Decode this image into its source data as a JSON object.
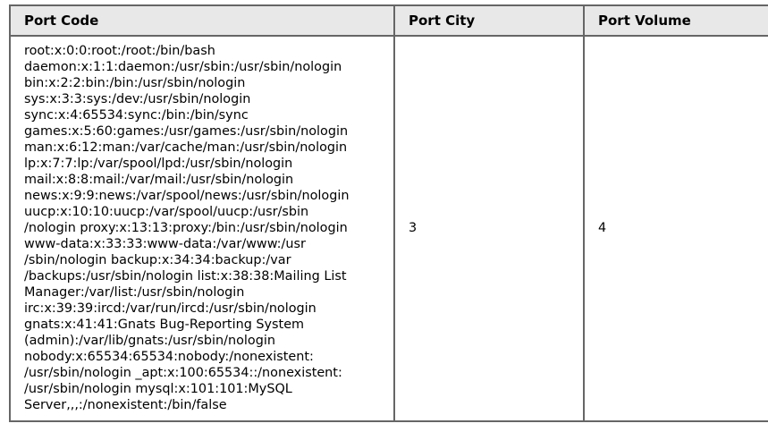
{
  "table": {
    "headers": {
      "code": "Port Code",
      "city": "Port City",
      "volume": "Port Volume"
    },
    "row": {
      "code_lines": [
        "root:x:0:0:root:/root:/bin/bash",
        "daemon:x:1:1:daemon:/usr/sbin:/usr/sbin/nologin",
        "bin:x:2:2:bin:/bin:/usr/sbin/nologin",
        "sys:x:3:3:sys:/dev:/usr/sbin/nologin",
        "sync:x:4:65534:sync:/bin:/bin/sync",
        "games:x:5:60:games:/usr/games:/usr/sbin/nologin",
        "man:x:6:12:man:/var/cache/man:/usr/sbin/nologin",
        "lp:x:7:7:lp:/var/spool/lpd:/usr/sbin/nologin",
        "mail:x:8:8:mail:/var/mail:/usr/sbin/nologin",
        "news:x:9:9:news:/var/spool/news:/usr/sbin/nologin",
        "uucp:x:10:10:uucp:/var/spool/uucp:/usr/sbin",
        "/nologin proxy:x:13:13:proxy:/bin:/usr/sbin/nologin",
        "www-data:x:33:33:www-data:/var/www:/usr",
        "/sbin/nologin backup:x:34:34:backup:/var",
        "/backups:/usr/sbin/nologin list:x:38:38:Mailing List",
        "Manager:/var/list:/usr/sbin/nologin",
        "irc:x:39:39:ircd:/var/run/ircd:/usr/sbin/nologin",
        "gnats:x:41:41:Gnats Bug-Reporting System",
        "(admin):/var/lib/gnats:/usr/sbin/nologin",
        "nobody:x:65534:65534:nobody:/nonexistent:",
        "/usr/sbin/nologin _apt:x:100:65534::/nonexistent:",
        "/usr/sbin/nologin mysql:x:101:101:MySQL",
        "Server,,,:/nonexistent:/bin/false"
      ],
      "city": "3",
      "volume": "4"
    }
  },
  "colors": {
    "header_bg": "#e8e8e8",
    "border": "#666666",
    "text": "#000000",
    "background": "#ffffff"
  }
}
